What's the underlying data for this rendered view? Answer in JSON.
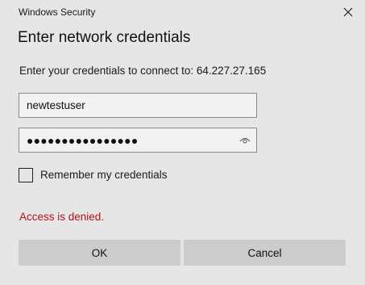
{
  "window": {
    "title": "Windows Security"
  },
  "dialog": {
    "heading": "Enter network credentials",
    "prompt": "Enter your credentials to connect to: 64.227.27.165"
  },
  "username": {
    "value": "newtestuser"
  },
  "password": {
    "masked_value": "●●●●●●●●●●●●●●●●",
    "reveal_icon": "eye-icon"
  },
  "remember": {
    "label": "Remember my credentials",
    "checked": false
  },
  "error": {
    "message": "Access is denied.",
    "color": "#b40f17"
  },
  "buttons": {
    "ok_label": "OK",
    "cancel_label": "Cancel"
  },
  "icons": {
    "close": "close-icon"
  }
}
